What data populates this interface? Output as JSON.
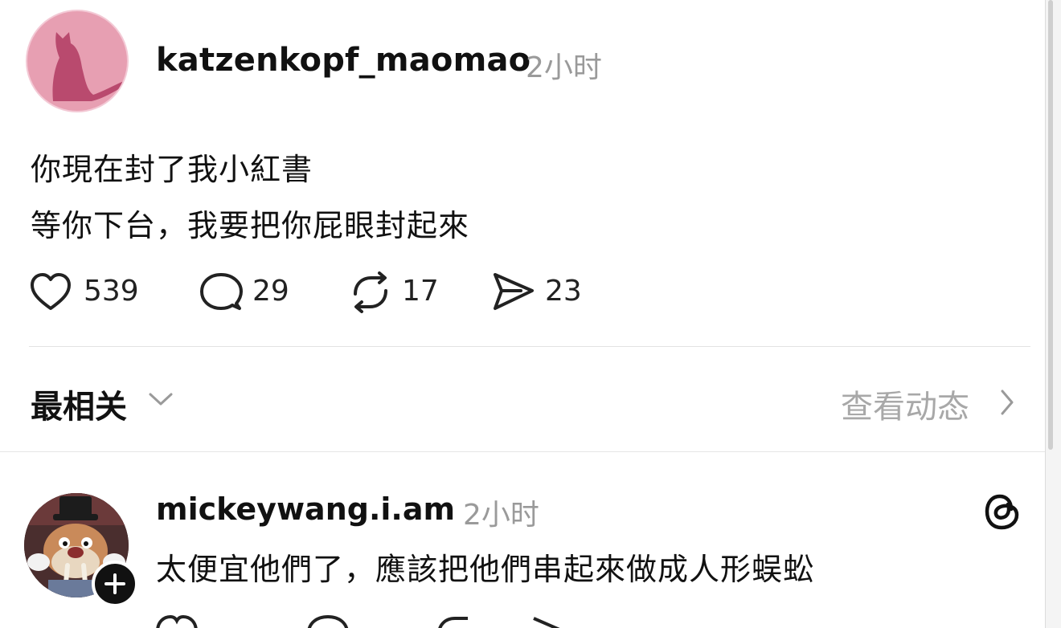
{
  "post": {
    "username": "katzenkopf_maomao",
    "time": "2小时",
    "lines": [
      "你現在封了我小紅書",
      "等你下台，我要把你屁眼封起來"
    ],
    "likes": "539",
    "replies": "29",
    "reposts": "17",
    "shares": "23",
    "avatar_color": "#e79fb2",
    "avatar_icon": "cat-silhouette-icon"
  },
  "sort": {
    "label": "最相关",
    "view_activity": "查看动态"
  },
  "reply": {
    "username": "mickeywang.i.am",
    "time": "2小时",
    "text": "太便宜他們了，應該把他們串起來做成人形蜈蚣"
  },
  "colors": {
    "text": "#111111",
    "muted": "#9a9a9a",
    "divider": "#e3e3e3"
  }
}
